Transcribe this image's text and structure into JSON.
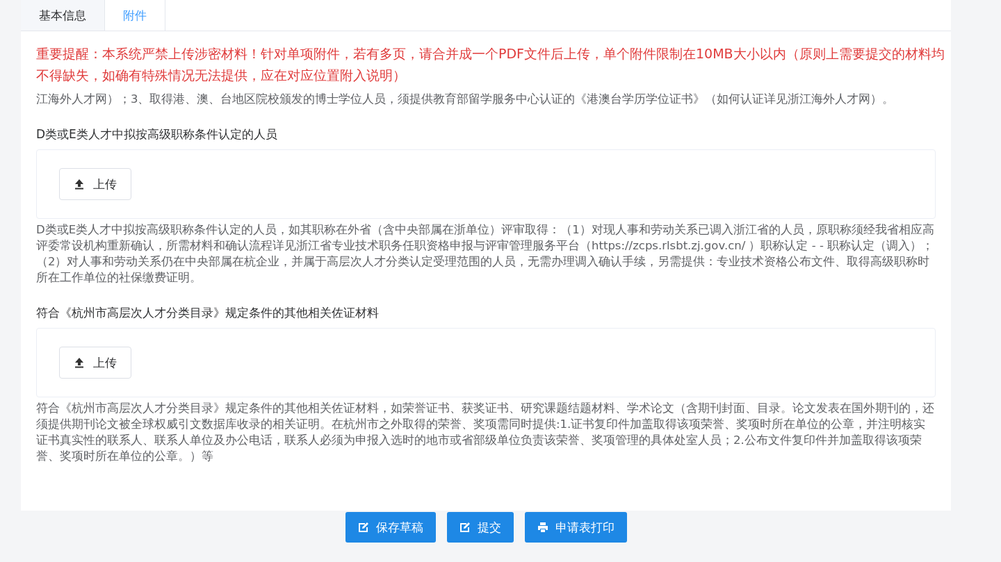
{
  "tabs": [
    {
      "label": "基本信息",
      "selected": false
    },
    {
      "label": "附件",
      "selected": true
    }
  ],
  "notice": "重要提醒：本系统严禁上传涉密材料！针对单项附件，若有多页，请合并成一个PDF文件后上传，单个附件限制在10MB大小以内（原则上需要提交的材料均不得缺失，如确有特殊情况无法提供，应在对应位置附入说明）",
  "sections": [
    {
      "description": "江海外人才网）；3、取得港、澳、台地区院校颁发的博士学位人员，须提供教育部留学服务中心认证的《港澳台学历学位证书》（如何认证详见浙江海外人才网）。"
    },
    {
      "title": "D类或E类人才中拟按高级职称条件认定的人员",
      "upload_button": "上传",
      "description": "D类或E类人才中拟按高级职称条件认定的人员，如其职称在外省（含中央部属在浙单位）评审取得：（1）对现人事和劳动关系已调入浙江省的人员，原职称须经我省相应高评委常设机构重新确认，所需材料和确认流程详见浙江省专业技术职务任职资格申报与评审管理服务平台（https://zcps.rlsbt.zj.gov.cn/ ）职称认定 - - 职称认定（调入）；（2）对人事和劳动关系仍在中央部属在杭企业，并属于高层次人才分类认定受理范围的人员，无需办理调入确认手续，另需提供：专业技术资格公布文件、取得高级职称时所在工作单位的社保缴费证明。"
    },
    {
      "title": "符合《杭州市高层次人才分类目录》规定条件的其他相关佐证材料",
      "upload_button": "上传",
      "description": "符合《杭州市高层次人才分类目录》规定条件的其他相关佐证材料，如荣誉证书、获奖证书、研究课题结题材料、学术论文（含期刊封面、目录。论文发表在国外期刊的，还须提供期刊论文被全球权威引文数据库收录的相关证明。在杭州市之外取得的荣誉、奖项需同时提供:1.证书复印件加盖取得该项荣誉、奖项时所在单位的公章，并注明核实证书真实性的联系人、联系人单位及办公电话，联系人必须为申报入选时的地市或省部级单位负责该荣誉、奖项管理的具体处室人员；2.公布文件复印件并加盖取得该项荣誉、奖项时所在单位的公章。）等"
    }
  ],
  "actions": [
    {
      "kind": "edit",
      "label": "保存草稿"
    },
    {
      "kind": "edit",
      "label": "提交"
    },
    {
      "kind": "print",
      "label": "申请表打印"
    }
  ]
}
